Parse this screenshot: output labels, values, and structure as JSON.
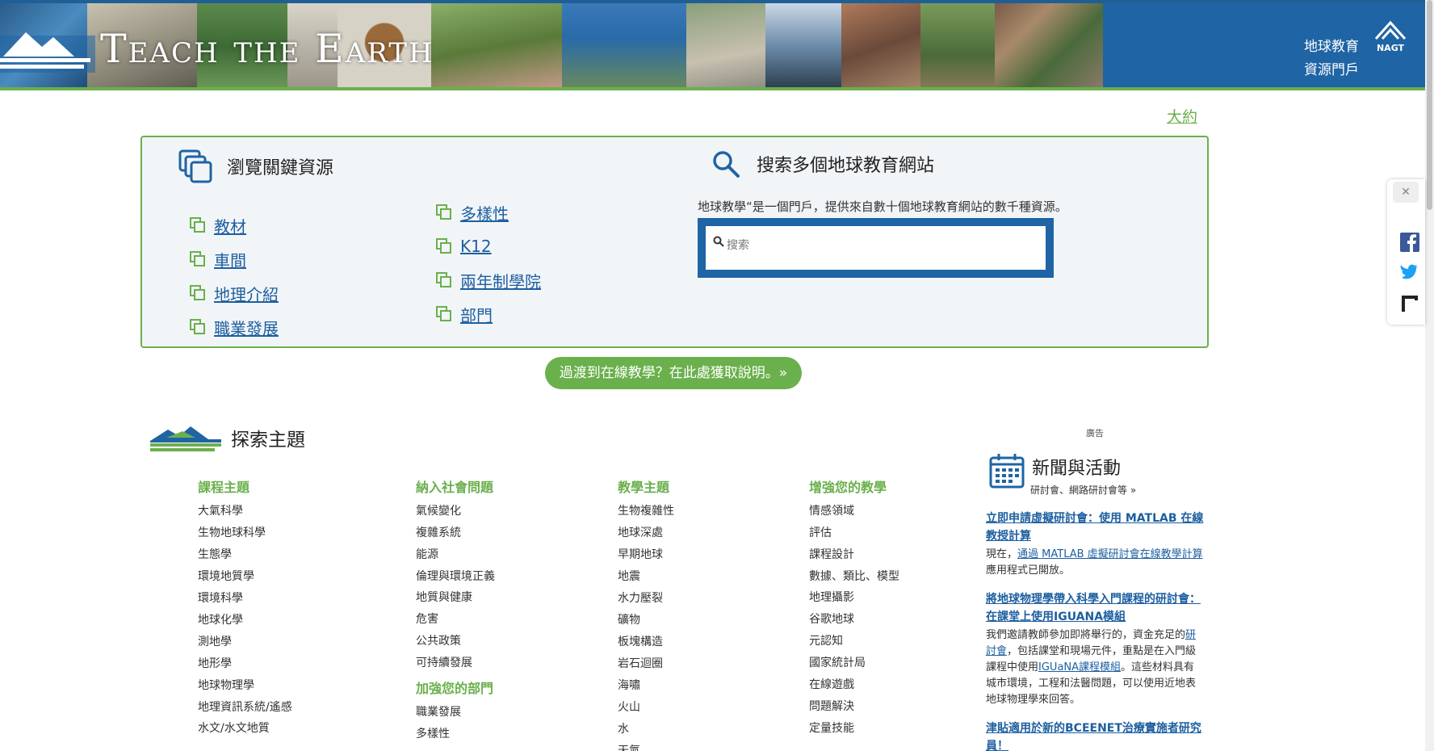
{
  "header": {
    "logo_text": "Teach the Earth",
    "portal_line1": "地球教育",
    "portal_line2": "資源門戶",
    "org": "NAGT"
  },
  "about_link": "大約",
  "browse": {
    "title": "瀏覽關鍵資源",
    "left_links": [
      "教材",
      "車間",
      "地理介紹",
      "職業發展"
    ],
    "right_links": [
      "多樣性",
      "K12",
      "兩年制學院",
      "部門"
    ]
  },
  "search": {
    "title": "搜索多個地球教育網站",
    "description": "地球教學“是一個門戶，提供來自數十個地球教育網站的數千種資源。",
    "placeholder": "搜索"
  },
  "cta_label": "過渡到在線教學？在此處獲取說明。»",
  "explore": {
    "title": "探索主題",
    "columns": [
      {
        "heading": "課程主題",
        "items": [
          "大氣科學",
          "生物地球科學",
          "生態學",
          "環境地質學",
          "環境科學",
          "地球化學",
          "測地學",
          "地形學",
          "地球物理學",
          "地理資訊系統/遙感",
          "水文/水文地質"
        ]
      },
      {
        "heading": "納入社會問題",
        "items": [
          "氣候變化",
          "複雜系統",
          "能源",
          "倫理與環境正義",
          "地質與健康",
          "危害",
          "公共政策",
          "可持續發展"
        ],
        "sub_heading": "加強您的部門",
        "sub_items": [
          "職業發展",
          "多樣性"
        ]
      },
      {
        "heading": "教學主題",
        "items": [
          "生物複雜性",
          "地球深處",
          "早期地球",
          "地震",
          "水力壓裂",
          "礦物",
          "板塊構造",
          "岩石迴圈",
          "海嘯",
          "火山",
          "水",
          "天氣"
        ]
      },
      {
        "heading": "增強您的教學",
        "items": [
          "情感領域",
          "評估",
          "課程設計",
          "數據、類比、模型",
          "地理攝影",
          "谷歌地球",
          "元認知",
          "國家統計局",
          "在線遊戲",
          "問題解決",
          "定量技能"
        ]
      }
    ]
  },
  "news": {
    "ad_label": "廣告",
    "title": "新聞與活動",
    "subtitle": "研討會、網路研討會等 »",
    "items": [
      {
        "link": "立即申請虛擬研討會：使用 MATLAB 在線教授計算",
        "body_prefix": "現在，",
        "body_link": "通過 MATLAB 虛擬研討會在線教學計算",
        "body_suffix": "應用程式已開放。"
      },
      {
        "link": "將地球物理學帶入科學入門課程的研討會：在課堂上使用IGUANA模組",
        "body_prefix": "我們邀請教師參加即將舉行的，資金充足的",
        "body_link": "研討會",
        "body_mid": "，包括課堂和現場元件，重點是在入門級課程中使用",
        "body_link2": "IGUaNA課程模組",
        "body_suffix": "。這些材料具有城市環境，工程和法醫問題，可以使用近地表地球物理學來回答。"
      },
      {
        "link": "津貼適用於新的BCEENET治療實施者研究員！"
      }
    ]
  },
  "colors": {
    "brand_blue": "#1f64a4",
    "brand_green": "#6ab04c",
    "link": "#1d5fa0"
  }
}
